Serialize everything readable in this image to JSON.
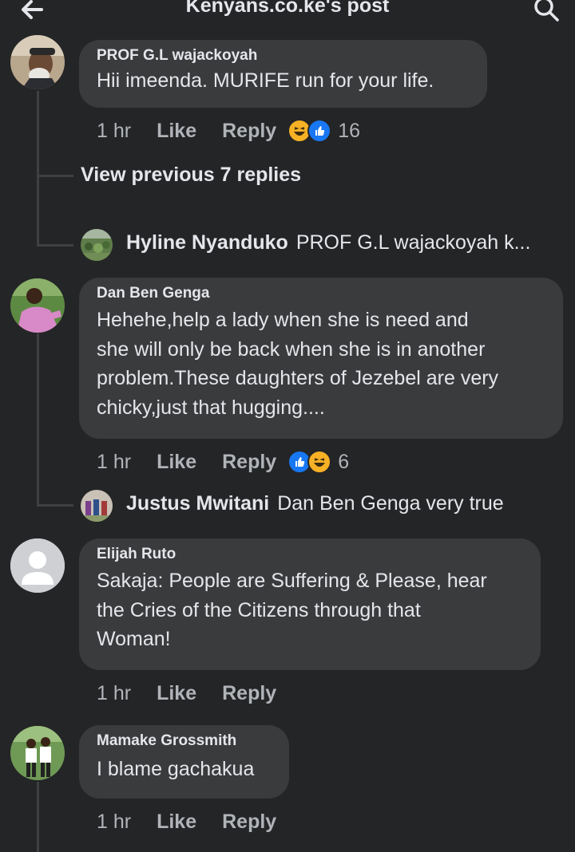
{
  "header": {
    "title": "Kenyans.co.ke's post",
    "back_icon": "arrow-left-icon",
    "search_icon": "search-icon"
  },
  "colors": {
    "background": "#242526",
    "bubble": "#3a3b3c",
    "secondary_text": "#b0b3b8",
    "like_blue": "#1877f2",
    "haha_yellow": "#f7b125"
  },
  "comments": [
    {
      "author": "PROF G.L wajackoyah",
      "text": "Hii imeenda. MURIFE run for your life.",
      "time": "1 hr",
      "like": "Like",
      "reply": "Reply",
      "reaction_icons": [
        "haha-icon",
        "like-icon"
      ],
      "reaction_count": "16",
      "view_previous": "View previous 7 replies",
      "reply_preview": {
        "author": "Hyline Nyanduko",
        "text": "PROF G.L wajackoyah k..."
      }
    },
    {
      "author": "Dan Ben Genga",
      "lines": [
        "Hehehe,help a lady when she is need and",
        "she will only be back when she is in another",
        "problem.These daughters of Jezebel are very",
        "chicky,just that hugging...."
      ],
      "time": "1 hr",
      "like": "Like",
      "reply": "Reply",
      "reaction_icons": [
        "like-icon",
        "haha-icon"
      ],
      "reaction_count": "6",
      "reply_preview": {
        "author": "Justus Mwitani",
        "text": "Dan Ben Genga very true"
      }
    },
    {
      "author": "Elijah Ruto",
      "lines": [
        "Sakaja: People are Suffering & Please, hear",
        "the Cries of the Citizens through that",
        "Woman!"
      ],
      "time": "1 hr",
      "like": "Like",
      "reply": "Reply"
    },
    {
      "author": "Mamake Grossmith",
      "text": "I blame gachakua",
      "time": "1 hr",
      "like": "Like",
      "reply": "Reply"
    }
  ]
}
